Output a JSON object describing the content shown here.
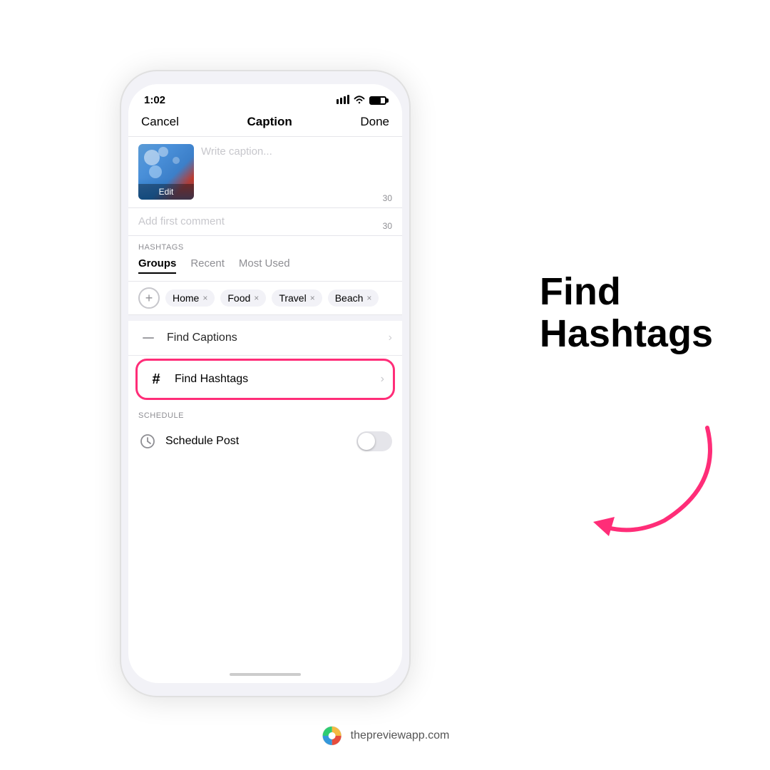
{
  "statusBar": {
    "time": "1:02",
    "signalIcon": "▐▐▐",
    "wifiIcon": "wifi",
    "batteryIcon": "battery"
  },
  "nav": {
    "cancel": "Cancel",
    "title": "Caption",
    "done": "Done"
  },
  "caption": {
    "placeholder": "Write caption...",
    "charCount": "30",
    "thumbnailEdit": "Edit"
  },
  "firstComment": {
    "placeholder": "Add first comment",
    "charCount": "30"
  },
  "hashtags": {
    "sectionLabel": "HASHTAGS",
    "tabs": [
      {
        "label": "Groups",
        "active": true
      },
      {
        "label": "Recent",
        "active": false
      },
      {
        "label": "Most Used",
        "active": false
      }
    ],
    "chips": [
      {
        "label": "Home"
      },
      {
        "label": "Food"
      },
      {
        "label": "Travel"
      },
      {
        "label": "Beach"
      }
    ]
  },
  "menu": {
    "findCaptions": {
      "label": "Find Captions",
      "icon": "—"
    },
    "findHashtags": {
      "label": "Find Hashtags",
      "icon": "#"
    }
  },
  "schedule": {
    "sectionLabel": "SCHEDULE",
    "label": "Schedule Post"
  },
  "sidebar": {
    "findHashtagsHeading": "Find\nHashtags"
  },
  "branding": {
    "url": "thepreviewapp.com"
  },
  "colors": {
    "accent": "#ff2d78",
    "arrowColor": "#ff2d78"
  }
}
